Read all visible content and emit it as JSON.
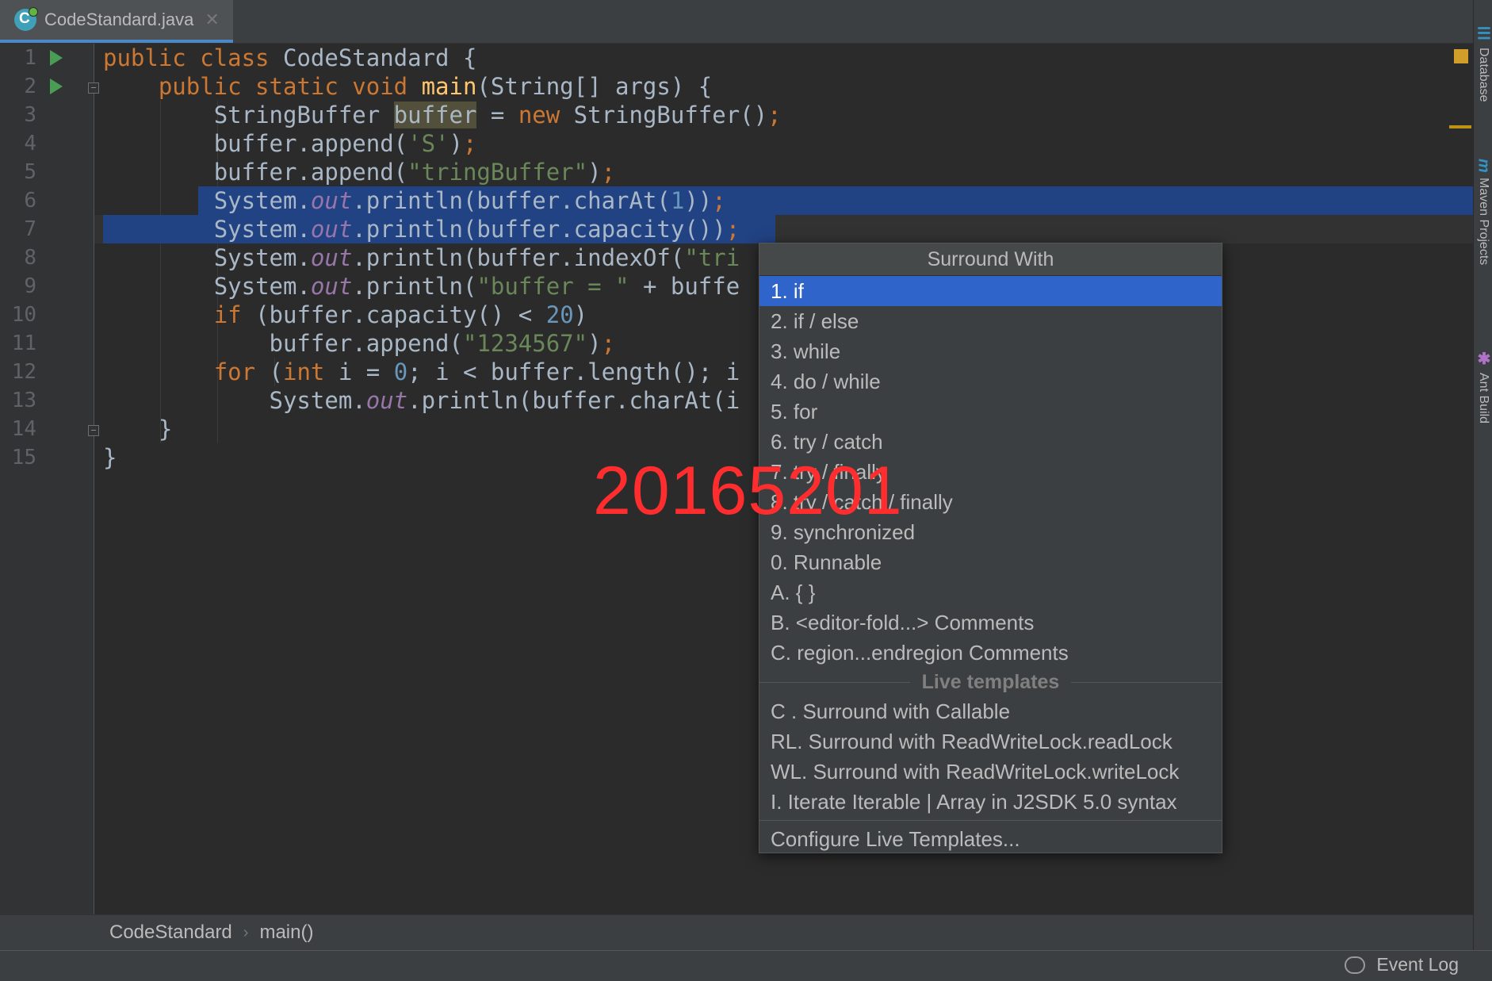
{
  "tab": {
    "filename": "CodeStandard.java",
    "close": "✕",
    "icon_letter": "C"
  },
  "gutter": {
    "line_numbers": [
      "1",
      "2",
      "3",
      "4",
      "5",
      "6",
      "7",
      "8",
      "9",
      "10",
      "11",
      "12",
      "13",
      "14",
      "15"
    ]
  },
  "code": {
    "l1": [
      "public class ",
      "CodeStandard {"
    ],
    "l2": [
      "public static void ",
      "main",
      "(String[] args) {"
    ],
    "l3": [
      "StringBuffer ",
      "buffer",
      " = ",
      "new ",
      "StringBuffer()",
      ";"
    ],
    "l4": [
      "buffer.append(",
      "'S'",
      ")",
      ";"
    ],
    "l5": [
      "buffer.append(",
      "\"tringBuffer\"",
      ")",
      ";"
    ],
    "l6": [
      "System.",
      "out",
      ".println(buffer.charAt(",
      "1",
      "))",
      ";"
    ],
    "l7": [
      "System.",
      "out",
      ".println(buffer.capacity())",
      ";"
    ],
    "l8": [
      "System.",
      "out",
      ".println(buffer.indexOf(",
      "\"tri"
    ],
    "l9": [
      "System.",
      "out",
      ".println(",
      "\"buffer = \"",
      " + buffe"
    ],
    "l10": [
      "if ",
      "(buffer.capacity() < ",
      "20",
      ")"
    ],
    "l11": [
      "buffer.append(",
      "\"1234567\"",
      ")",
      ";"
    ],
    "l12": [
      "for ",
      "(",
      "int ",
      "i = ",
      "0",
      "; i < buffer.length(); i"
    ],
    "l13": [
      "System.",
      "out",
      ".println(buffer.charAt(i"
    ],
    "l14": [
      "}"
    ],
    "l15": [
      "}"
    ]
  },
  "right_tools": {
    "database": "Database",
    "maven": "Maven Projects",
    "ant": "Ant Build",
    "maven_sym": "m",
    "database_sym": "☰",
    "ant_sym": "✱"
  },
  "popup": {
    "title": "Surround With",
    "items": [
      "1. if",
      "2. if / else",
      "3. while",
      "4. do / while",
      "5. for",
      "6. try / catch",
      "7. try / finally",
      "8. try / catch / finally",
      "9. synchronized",
      "0. Runnable",
      "A. { }",
      "B. <editor-fold...> Comments",
      "C. region...endregion Comments"
    ],
    "section_title": "Live templates",
    "live_items": [
      "C . Surround with Callable",
      "RL. Surround with ReadWriteLock.readLock",
      "WL. Surround with ReadWriteLock.writeLock",
      "I. Iterate Iterable | Array in J2SDK 5.0 syntax"
    ],
    "footer": "Configure Live Templates..."
  },
  "breadcrumb": {
    "class": "CodeStandard",
    "separator": "›",
    "method": "main()"
  },
  "statusbar": {
    "event_log": "Event Log"
  },
  "watermark": "20165201"
}
